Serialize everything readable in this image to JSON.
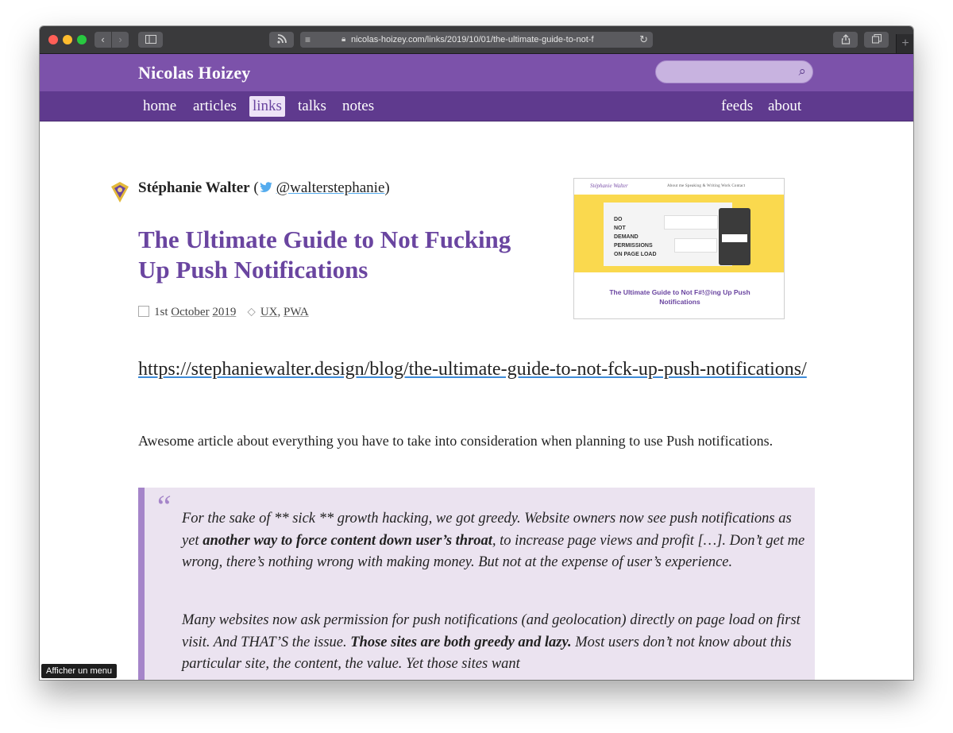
{
  "browser": {
    "url": "nicolas-hoizey.com/links/2019/10/01/the-ultimate-guide-to-not-f",
    "tooltip": "Afficher un menu"
  },
  "site": {
    "title": "Nicolas Hoizey",
    "nav": [
      {
        "label": "home"
      },
      {
        "label": "articles"
      },
      {
        "label": "links",
        "active": true
      },
      {
        "label": "talks"
      },
      {
        "label": "notes"
      }
    ],
    "nav_right": [
      {
        "label": "feeds"
      },
      {
        "label": "about"
      }
    ]
  },
  "post": {
    "author_name": "Stéphanie Walter",
    "author_open": " (",
    "author_handle": "@walterstephanie",
    "author_close": ")",
    "title": "The Ultimate Guide to Not Fucking Up Push Notifications",
    "date_day": "1st",
    "date_month": "October",
    "date_year": "2019",
    "tags": [
      "UX",
      "PWA"
    ],
    "link": "https://stephaniewalter.design/blog/the-ultimate-guide-to-not-fck-up-push-notifications/",
    "description": "Awesome article about everything you have to take into consideration when planning to use Push notifications.",
    "quote_mark": "“",
    "quote_p1_a": "For the sake of ** sick ** growth hacking, we got greedy. Website owners now see push notifications as yet ",
    "quote_p1_b": "another way to force content down user’s throat",
    "quote_p1_c": ", to increase page views and profit […]. Don’t get me wrong, there’s nothing wrong with making money. But not at the expense of user’s experience.",
    "quote_p2_a": "Many websites now ask permission for push notifications (and geolocation) directly on page load on first visit. And THAT’S the issue. ",
    "quote_p2_b": "Those sites are both greedy and lazy.",
    "quote_p2_c": " Most users don’t not know about this particular site, the content, the value. Yet those sites want"
  },
  "thumbnail": {
    "logo": "Stéphanie Walter",
    "links": "About me    Speaking & Writing    Work    Contact",
    "lines": [
      "DO",
      "NOT",
      "DEMAND",
      "PERMISSIONS",
      "ON PAGE LOAD"
    ],
    "title": "The Ultimate Guide to Not F#!@ing Up Push Notifications"
  }
}
